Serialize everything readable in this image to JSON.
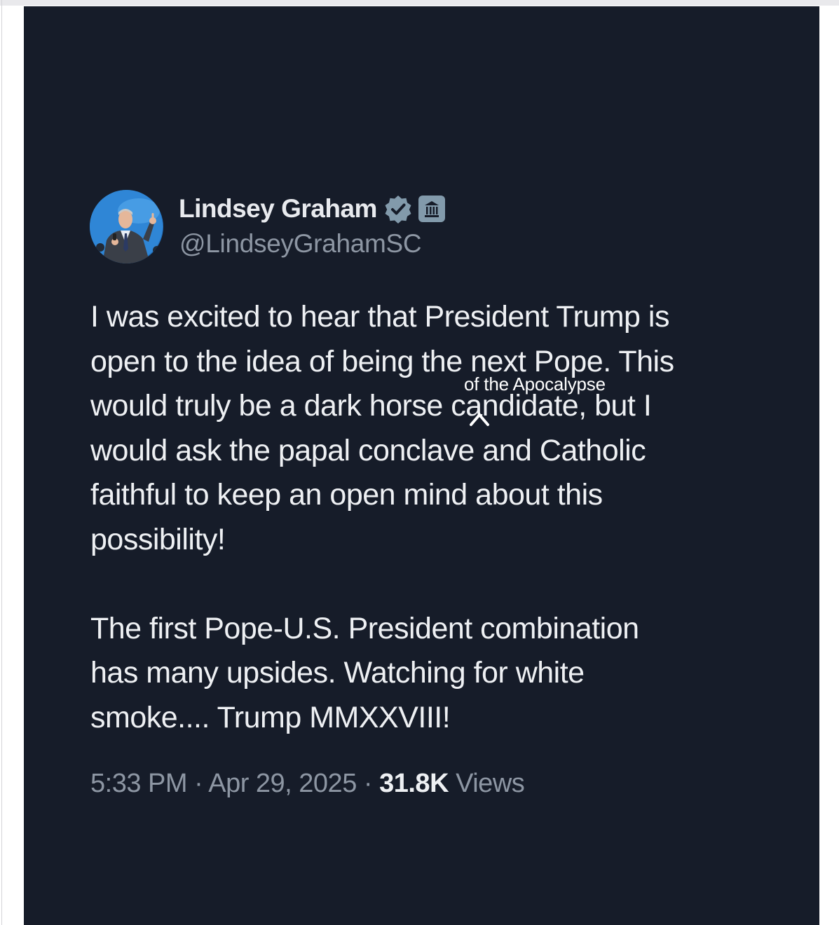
{
  "tweet": {
    "display_name": "Lindsey Graham",
    "handle": "@LindseyGrahamSC",
    "paragraph_1_lines": [
      "I was excited to hear that President Trump is",
      "open to the idea of being the next Pope. This",
      "would truly be a dark horse candidate, but I",
      "would ask the papal conclave and Catholic",
      "faithful to keep an open mind about this",
      "possibility!"
    ],
    "paragraph_2_lines": [
      "The first Pope-U.S. President combination",
      "has many upsides. Watching for white",
      "smoke.... Trump MMXXVIII!"
    ],
    "time": "5:33 PM",
    "separator": "·",
    "date": "Apr 29, 2025",
    "views_count": "31.8K",
    "views_label": "Views"
  },
  "annotation": {
    "inserted_text": "of the Apocalypse",
    "caret_symbol": "^"
  },
  "icons": {
    "verified": "verified-badge-icon",
    "government": "government-building-icon"
  },
  "colors": {
    "card_background": "#161c29",
    "text_primary": "#eef0f3",
    "text_secondary": "#8d96a3",
    "verified_badge": "#829aab",
    "gov_badge": "#829aab"
  }
}
